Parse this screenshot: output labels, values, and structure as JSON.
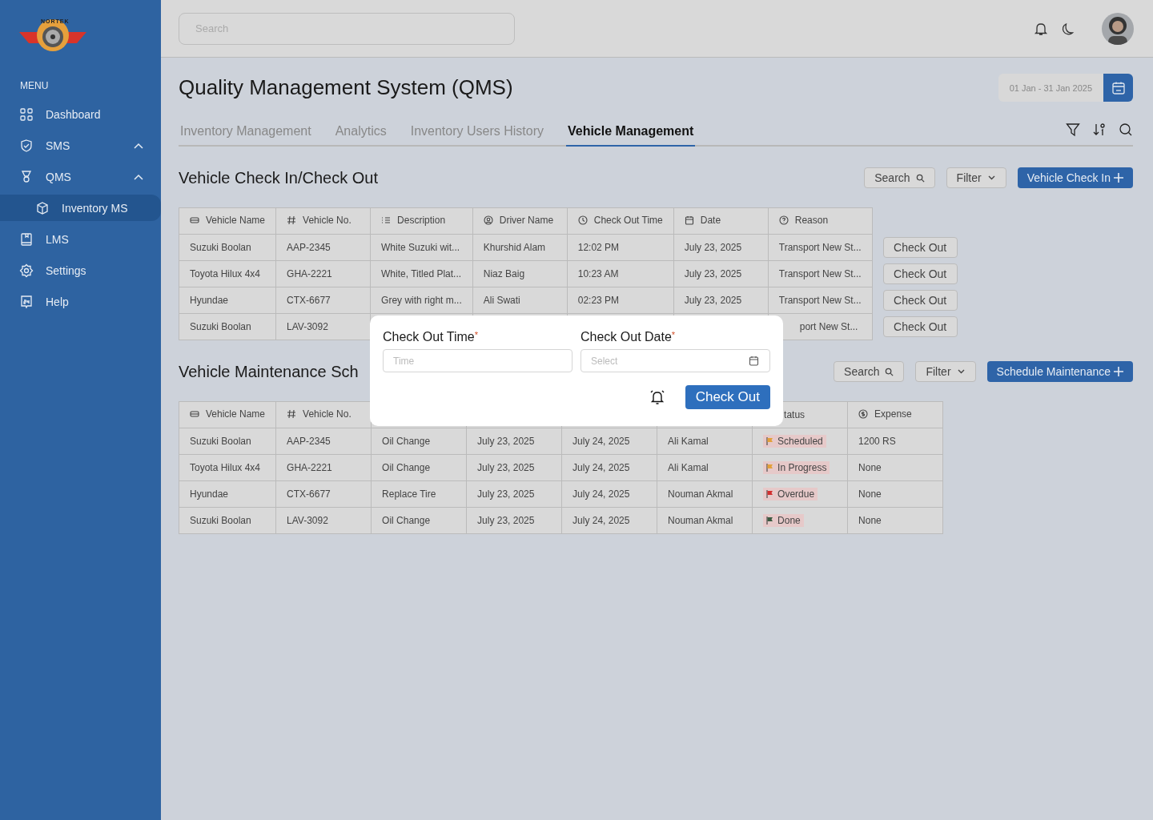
{
  "logo": {
    "text": "NORTEK"
  },
  "sidebar": {
    "heading": "MENU",
    "items": [
      {
        "label": "Dashboard",
        "selected": false
      },
      {
        "label": "SMS",
        "selected": false,
        "expanded": true
      },
      {
        "label": "QMS",
        "selected": false,
        "expanded": true,
        "children": [
          {
            "label": "Inventory MS",
            "selected": true
          }
        ]
      },
      {
        "label": "LMS",
        "selected": false
      },
      {
        "label": "Settings",
        "selected": false
      },
      {
        "label": "Help",
        "selected": false
      }
    ]
  },
  "header": {
    "search": {
      "placeholder": "Search"
    }
  },
  "page": {
    "title": "Quality Management System (QMS)",
    "date_range": "01 Jan - 31 Jan 2025"
  },
  "tabs": [
    {
      "label": "Inventory Management",
      "selected": false
    },
    {
      "label": "Analytics",
      "selected": false
    },
    {
      "label": "Inventory Users History",
      "selected": false
    },
    {
      "label": "Vehicle Management",
      "selected": true
    }
  ],
  "check_section": {
    "title": "Vehicle Check In/Check Out",
    "search": "Search",
    "filter": "Filter",
    "primary": "Vehicle Check In",
    "columns": [
      {
        "label": "Vehicle Name"
      },
      {
        "label": "Vehicle No."
      },
      {
        "label": "Description"
      },
      {
        "label": "Driver Name"
      },
      {
        "label": "Check Out Time"
      },
      {
        "label": "Date"
      },
      {
        "label": "Reason"
      }
    ],
    "rows": [
      {
        "cells": [
          "Suzuki Boolan",
          "AAP-2345",
          "White Suzuki wit...",
          "Khurshid Alam",
          "12:02 PM",
          "July 23, 2025",
          "Transport New St..."
        ],
        "action": "Check Out"
      },
      {
        "cells": [
          "Toyota Hilux 4x4",
          "GHA-2221",
          "White, Titled Plat...",
          "Niaz Baig",
          "10:23 AM",
          "July 23, 2025",
          "Transport New St..."
        ],
        "action": "Check Out"
      },
      {
        "cells": [
          "Hyundae",
          "CTX-6677",
          "Grey with right m...",
          "Ali Swati",
          "02:23 PM",
          "July 23, 2025",
          "Transport New St..."
        ],
        "action": "Check Out"
      },
      {
        "cells": [
          "Suzuki Boolan",
          "LAV-3092",
          null,
          null,
          null,
          null,
          "port New St..."
        ],
        "reason_cut": true,
        "action": "Check Out"
      }
    ]
  },
  "maintenance_section": {
    "title": "Vehicle Maintenance Sch",
    "search": "Search",
    "filter": "Filter",
    "primary": "Schedule Maintenance",
    "columns": [
      {
        "label": "Vehicle Name"
      },
      {
        "label": "Vehicle No."
      },
      {},
      {},
      {},
      {},
      {
        "label": "tatus",
        "cut": true
      },
      {
        "label": "Expense"
      }
    ],
    "rows": [
      {
        "cells": [
          "Suzuki Boolan",
          "AAP-2345",
          "Oil Change",
          "July 23, 2025",
          "July 24, 2025",
          "Ali Kamal",
          null,
          "1200 RS"
        ],
        "status": {
          "label": "Scheduled",
          "color": "#e3a03a"
        }
      },
      {
        "cells": [
          "Toyota Hilux 4x4",
          "GHA-2221",
          "Oil Change",
          "July 23, 2025",
          "July 24, 2025",
          "Ali Kamal",
          null,
          "None"
        ],
        "status": {
          "label": "In Progress",
          "color": "#e3a03a"
        }
      },
      {
        "cells": [
          "Hyundae",
          "CTX-6677",
          "Replace Tire",
          "July 23, 2025",
          "July 24, 2025",
          "Nouman Akmal",
          null,
          "None"
        ],
        "status": {
          "label": "Overdue",
          "color": "#d22f2f"
        }
      },
      {
        "cells": [
          "Suzuki Boolan",
          "LAV-3092",
          "Oil Change",
          "July 23, 2025",
          "July 24, 2025",
          "Nouman Akmal",
          null,
          "None"
        ],
        "status": {
          "label": "Done",
          "color": "#3b5a40"
        }
      }
    ]
  },
  "modal": {
    "fields": [
      {
        "label": "Check Out Time",
        "required_mark": "*",
        "placeholder": "Time",
        "kind": "time"
      },
      {
        "label": "Check Out Date",
        "required_mark": "*",
        "placeholder": "Select",
        "kind": "date"
      }
    ],
    "button": "Check Out"
  }
}
